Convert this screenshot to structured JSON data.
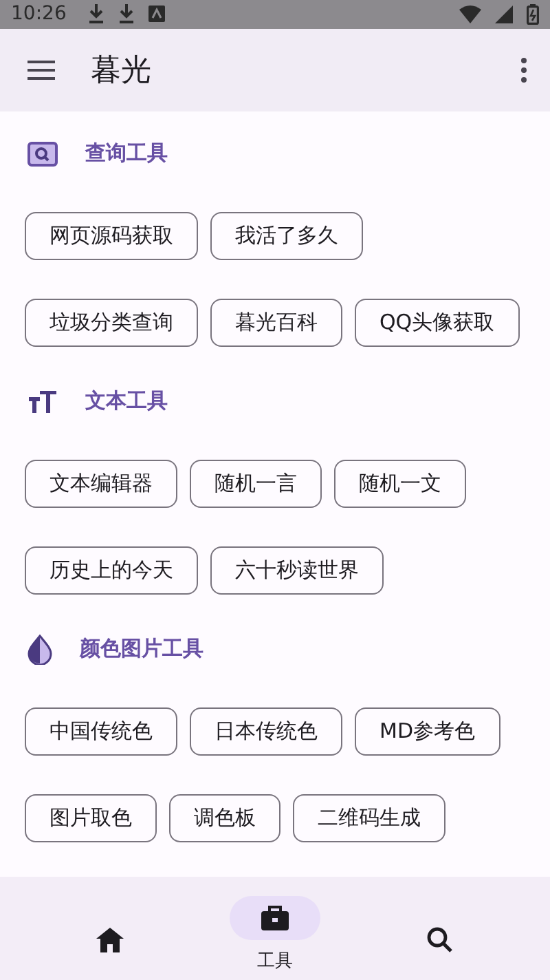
{
  "status_bar": {
    "time": "10:26"
  },
  "app_bar": {
    "title": "暮光"
  },
  "sections": [
    {
      "kind": "search",
      "title": "查询工具",
      "tools": [
        "网页源码获取",
        "我活了多久",
        "垃圾分类查询",
        "暮光百科",
        "QQ头像获取"
      ]
    },
    {
      "kind": "text",
      "title": "文本工具",
      "tools": [
        "文本编辑器",
        "随机一言",
        "随机一文",
        "历史上的今天",
        "六十秒读世界"
      ]
    },
    {
      "kind": "color",
      "title": "颜色图片工具",
      "tools": [
        "中国传统色",
        "日本传统色",
        "MD参考色",
        "图片取色",
        "调色板",
        "二维码生成"
      ]
    }
  ],
  "bottom_nav": [
    {
      "kind": "home",
      "selected": false
    },
    {
      "kind": "tools",
      "label": "工具",
      "selected": true
    },
    {
      "kind": "search",
      "selected": false
    }
  ]
}
